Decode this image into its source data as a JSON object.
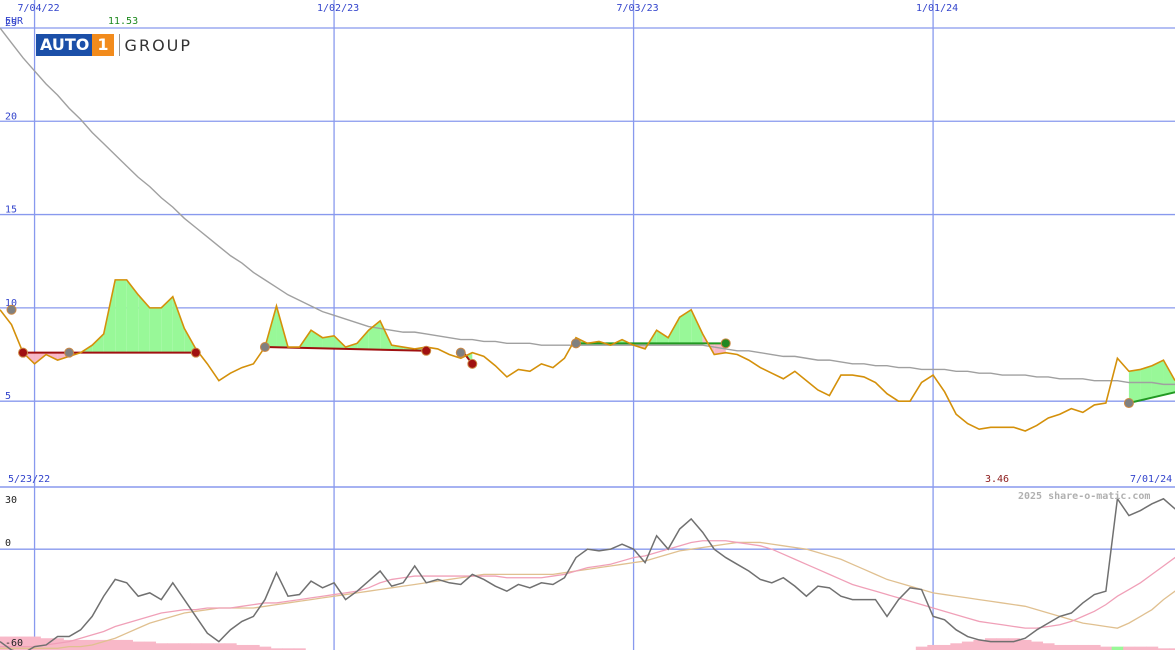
{
  "header": {
    "currency": "EUR",
    "peak_label": "11.53",
    "low_label": "3.46",
    "start_date": "5/23/22",
    "end_date": "7/01/24",
    "watermark": "2025 share-o-matic.com"
  },
  "logo": {
    "word": "AUTO",
    "digit": "1",
    "group": "GROUP"
  },
  "colors": {
    "price": "#d4900a",
    "average": "#a0a0a0",
    "gain_fill": "#98f898",
    "loss_fill": "#f8b8c8",
    "gridline": "#8899ee",
    "trend_down": "#a01010",
    "trend_up": "#229922",
    "oscillator": "#707070",
    "osc_avg_fast": "#f0a0b8",
    "osc_avg_slow": "#e0c090"
  },
  "chart_data": [
    {
      "type": "line",
      "panel": "price",
      "ylabel": "EUR",
      "ylim": [
        0.4,
        26.5
      ],
      "y_ticks": [
        5,
        10,
        15,
        20,
        25
      ],
      "x_tick_labels": [
        "7/04/22",
        "1/02/23",
        "7/03/23",
        "1/01/24"
      ],
      "x_tick_index": [
        3,
        29,
        55,
        81
      ],
      "grid": true,
      "series": [
        {
          "role": "price",
          "values": [
            9.9,
            9.1,
            7.6,
            7.0,
            7.5,
            7.2,
            7.4,
            7.6,
            8.0,
            8.6,
            11.5,
            11.5,
            10.7,
            10.0,
            10.0,
            10.6,
            8.9,
            7.8,
            7.0,
            6.1,
            6.5,
            6.8,
            7.0,
            7.9,
            10.1,
            7.9,
            7.9,
            8.8,
            8.4,
            8.5,
            7.9,
            8.1,
            8.8,
            9.3,
            8.0,
            7.9,
            7.8,
            7.9,
            7.8,
            7.5,
            7.3,
            7.6,
            7.4,
            6.9,
            6.3,
            6.7,
            6.6,
            7.0,
            6.8,
            7.3,
            8.4,
            8.1,
            8.2,
            8.0,
            8.3,
            8.0,
            7.8,
            8.8,
            8.4,
            9.5,
            9.9,
            8.6,
            7.5,
            7.6,
            7.5,
            7.2,
            6.8,
            6.5,
            6.2,
            6.6,
            6.1,
            5.6,
            5.3,
            6.4,
            6.4,
            6.3,
            6.0,
            5.4,
            5.0,
            5.0,
            6.0,
            6.4,
            5.5,
            4.3,
            3.8,
            3.5,
            3.6,
            3.6,
            3.6,
            3.4,
            3.7,
            4.1,
            4.3,
            4.6,
            4.4,
            4.8,
            4.9,
            7.3,
            6.6,
            6.7,
            6.9,
            7.2,
            6.1
          ]
        },
        {
          "role": "moving-average",
          "values": [
            25.0,
            24.2,
            23.4,
            22.7,
            22.0,
            21.4,
            20.7,
            20.1,
            19.4,
            18.8,
            18.2,
            17.6,
            17.0,
            16.5,
            15.9,
            15.4,
            14.8,
            14.3,
            13.8,
            13.3,
            12.8,
            12.4,
            11.9,
            11.5,
            11.1,
            10.7,
            10.4,
            10.1,
            9.8,
            9.6,
            9.4,
            9.2,
            9.0,
            8.9,
            8.8,
            8.7,
            8.7,
            8.6,
            8.5,
            8.4,
            8.3,
            8.3,
            8.2,
            8.2,
            8.1,
            8.1,
            8.1,
            8.0,
            8.0,
            8.0,
            8.0,
            8.0,
            8.0,
            8.0,
            8.0,
            8.0,
            8.0,
            8.0,
            8.0,
            8.0,
            8.0,
            8.0,
            7.9,
            7.8,
            7.7,
            7.7,
            7.6,
            7.5,
            7.4,
            7.4,
            7.3,
            7.2,
            7.2,
            7.1,
            7.0,
            7.0,
            6.9,
            6.9,
            6.8,
            6.8,
            6.7,
            6.7,
            6.7,
            6.6,
            6.6,
            6.5,
            6.5,
            6.4,
            6.4,
            6.4,
            6.3,
            6.3,
            6.2,
            6.2,
            6.2,
            6.1,
            6.1,
            6.1,
            6.0,
            6.0,
            6.0,
            5.9,
            5.9
          ]
        }
      ],
      "trend_segments": [
        {
          "from_index": 2,
          "to_index": 17,
          "from_value": 7.6,
          "to_value": 7.6,
          "direction": "down"
        },
        {
          "from_index": 23,
          "to_index": 37,
          "from_value": 7.9,
          "to_value": 7.7,
          "direction": "down"
        },
        {
          "from_index": 40,
          "to_index": 41,
          "from_value": 7.8,
          "to_value": 7.0,
          "direction": "down"
        },
        {
          "from_index": 50,
          "to_index": 63,
          "from_value": 8.1,
          "to_value": 8.1,
          "direction": "up"
        },
        {
          "from_index": 98,
          "to_index": 107,
          "from_value": 4.9,
          "to_value": 6.2,
          "direction": "up"
        }
      ],
      "markers": [
        {
          "index": 1,
          "value": 9.9,
          "kind": "neutral"
        },
        {
          "index": 2,
          "value": 7.6,
          "kind": "sell"
        },
        {
          "index": 6,
          "value": 7.6,
          "kind": "neutral"
        },
        {
          "index": 17,
          "value": 7.6,
          "kind": "sell"
        },
        {
          "index": 23,
          "value": 7.9,
          "kind": "neutral"
        },
        {
          "index": 37,
          "value": 7.7,
          "kind": "sell"
        },
        {
          "index": 40,
          "value": 7.6,
          "kind": "neutral"
        },
        {
          "index": 41,
          "value": 7.0,
          "kind": "sell"
        },
        {
          "index": 50,
          "value": 8.1,
          "kind": "neutral"
        },
        {
          "index": 63,
          "value": 8.1,
          "kind": "buy"
        },
        {
          "index": 98,
          "value": 4.9,
          "kind": "neutral"
        }
      ]
    },
    {
      "type": "line",
      "panel": "oscillator",
      "ylim": [
        -60,
        37
      ],
      "y_ticks": [
        30,
        0,
        -60
      ],
      "grid": true,
      "series": [
        {
          "role": "oscillator",
          "values": [
            -55,
            -60,
            -62,
            -58,
            -57,
            -52,
            -52,
            -48,
            -40,
            -28,
            -18,
            -20,
            -28,
            -26,
            -30,
            -20,
            -30,
            -40,
            -50,
            -55,
            -48,
            -43,
            -40,
            -30,
            -14,
            -28,
            -27,
            -19,
            -23,
            -20,
            -30,
            -25,
            -19,
            -13,
            -22,
            -20,
            -10,
            -20,
            -18,
            -20,
            -21,
            -15,
            -18,
            -22,
            -25,
            -21,
            -23,
            -20,
            -21,
            -17,
            -5,
            0,
            -1,
            0,
            3,
            0,
            -8,
            8,
            0,
            12,
            18,
            10,
            0,
            -5,
            -9,
            -13,
            -18,
            -20,
            -17,
            -22,
            -28,
            -22,
            -23,
            -28,
            -30,
            -30,
            -30,
            -40,
            -30,
            -23,
            -24,
            -40,
            -42,
            -48,
            -52,
            -54,
            -55,
            -55,
            -55,
            -53,
            -48,
            -44,
            -40,
            -38,
            -32,
            -27,
            -25,
            30,
            20,
            23,
            27,
            30,
            24,
            25
          ]
        },
        {
          "role": "average-fast",
          "values": [
            -58,
            -58,
            -58,
            -58,
            -57,
            -56,
            -55,
            -53,
            -51,
            -49,
            -46,
            -44,
            -42,
            -40,
            -38,
            -37,
            -36,
            -36,
            -35,
            -35,
            -35,
            -34,
            -33,
            -32,
            -32,
            -31,
            -30,
            -29,
            -28,
            -27,
            -26,
            -25,
            -23,
            -20,
            -18,
            -17,
            -16,
            -16,
            -16,
            -16,
            -16,
            -16,
            -16,
            -16,
            -17,
            -17,
            -17,
            -17,
            -16,
            -15,
            -13,
            -11,
            -10,
            -9,
            -7,
            -5,
            -4,
            -2,
            0,
            2,
            4,
            5,
            5,
            5,
            4,
            3,
            2,
            0,
            -3,
            -6,
            -9,
            -12,
            -15,
            -18,
            -21,
            -23,
            -25,
            -27,
            -29,
            -31,
            -33,
            -35,
            -37,
            -39,
            -41,
            -43,
            -44,
            -45,
            -46,
            -47,
            -47,
            -46,
            -45,
            -43,
            -40,
            -37,
            -33,
            -28,
            -24,
            -20,
            -15,
            -10,
            -5,
            -1
          ]
        },
        {
          "role": "average-slow",
          "values": [
            -59,
            -59,
            -59,
            -59,
            -59,
            -59,
            -58,
            -58,
            -57,
            -55,
            -53,
            -50,
            -47,
            -44,
            -42,
            -40,
            -38,
            -37,
            -36,
            -35,
            -35,
            -35,
            -35,
            -34,
            -33,
            -32,
            -31,
            -30,
            -29,
            -28,
            -27,
            -26,
            -25,
            -24,
            -23,
            -22,
            -21,
            -20,
            -19,
            -18,
            -17,
            -16,
            -15,
            -15,
            -15,
            -15,
            -15,
            -15,
            -15,
            -14,
            -13,
            -12,
            -11,
            -10,
            -9,
            -8,
            -7,
            -5,
            -3,
            -1,
            0,
            1,
            2,
            3,
            4,
            4,
            4,
            3,
            2,
            1,
            0,
            -2,
            -4,
            -6,
            -9,
            -12,
            -15,
            -18,
            -20,
            -22,
            -24,
            -26,
            -27,
            -28,
            -29,
            -30,
            -31,
            -32,
            -33,
            -34,
            -36,
            -38,
            -40,
            -42,
            -44,
            -45,
            -46,
            -47,
            -44,
            -40,
            -36,
            -30,
            -25,
            -20
          ]
        }
      ],
      "histogram": {
        "values": [
          -52,
          -52,
          -52,
          -52,
          -53,
          -53,
          -54,
          -54,
          -54,
          -54,
          -54,
          -54,
          -55,
          -55,
          -56,
          -56,
          -56,
          -56,
          -56,
          -56,
          -56,
          -57,
          -57,
          -58,
          -59,
          -59,
          -59,
          -60,
          -60,
          -60,
          -60,
          -60,
          -60,
          -60,
          -60,
          -60,
          -60,
          -60,
          -60,
          -60,
          -60,
          -60,
          -60,
          -60,
          -60,
          -60,
          -60,
          -60,
          -60,
          -60,
          -60,
          -60,
          -60,
          -60,
          -60,
          -60,
          -60,
          -60,
          -60,
          -60,
          -60,
          -60,
          -60,
          -60,
          -60,
          -60,
          -60,
          -60,
          -60,
          -60,
          -60,
          -60,
          -60,
          -60,
          -60,
          -60,
          -60,
          -60,
          -60,
          -60,
          -58,
          -57,
          -57,
          -56,
          -55,
          -54,
          -53,
          -53,
          -53,
          -54,
          -55,
          -56,
          -57,
          -57,
          -57,
          -57,
          -58,
          -58,
          -58,
          -58,
          -58,
          -59,
          -59,
          -60
        ],
        "positive_index": [
          33,
          34,
          35,
          36,
          37,
          39,
          40,
          42,
          47,
          53,
          55,
          56,
          57,
          58,
          60,
          61,
          62,
          63,
          64,
          65,
          66,
          67,
          68,
          75,
          76,
          77,
          78,
          97
        ]
      }
    }
  ]
}
